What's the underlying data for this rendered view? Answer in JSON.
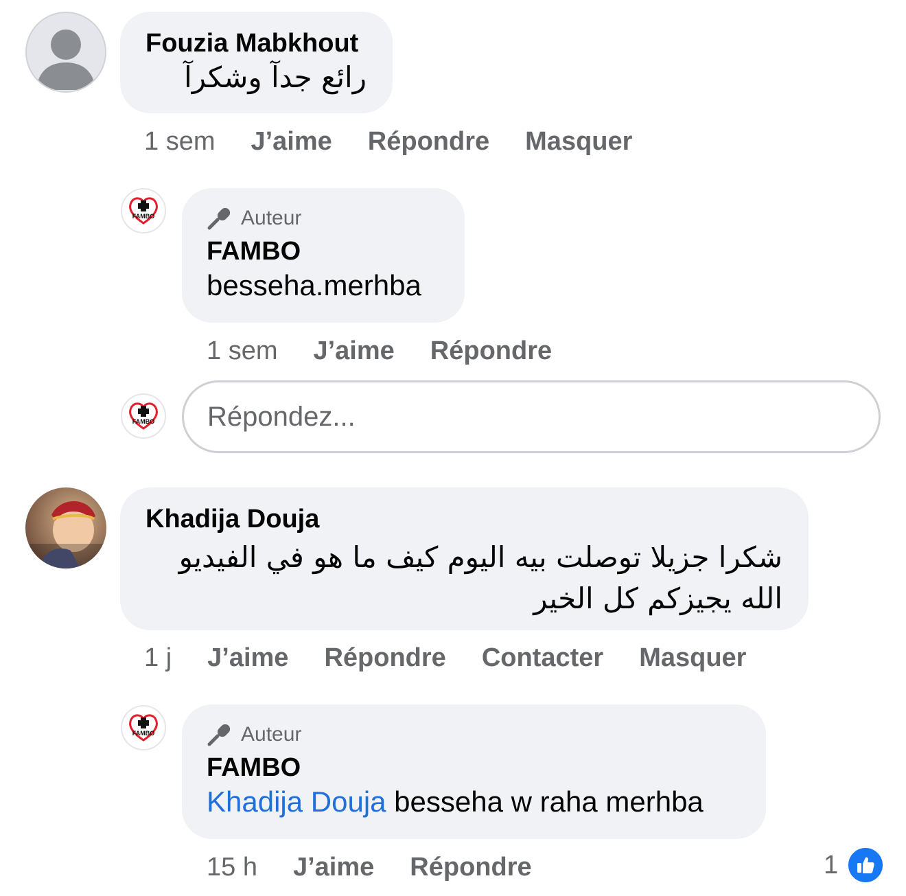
{
  "colors": {
    "bubble_bg": "#f0f2f5",
    "secondary_text": "#65676b",
    "mention": "#216fdb",
    "like_blue": "#1877f2",
    "brand_red": "#e41e2b"
  },
  "comments": [
    {
      "author": "Fouzia Mabkhout",
      "text": "رائع  جدآ  وشكرآ",
      "time": "1 sem",
      "actions": [
        "J’aime",
        "Répondre",
        "Masquer"
      ],
      "replies": [
        {
          "author_badge": "Auteur",
          "author": "FAMBO",
          "text": "besseha.merhba",
          "time": "1 sem",
          "actions": [
            "J’aime",
            "Répondre"
          ]
        }
      ],
      "reply_input": {
        "placeholder": "Répondez..."
      }
    },
    {
      "author": "Khadija Douja",
      "text": "شكرا جزيلا توصلت بيه اليوم كيف ما هو في الفيديو الله يجيزكم كل الخير",
      "time": "1 j",
      "actions": [
        "J’aime",
        "Répondre",
        "Contacter",
        "Masquer"
      ],
      "replies": [
        {
          "author_badge": "Auteur",
          "author": "FAMBO",
          "mention": "Khadija Douja",
          "text": " besseha w raha merhba",
          "time": "15 h",
          "actions": [
            "J’aime",
            "Répondre"
          ],
          "reaction_count": "1",
          "reaction_icon": "thumbs-up-icon"
        }
      ]
    }
  ],
  "icons": {
    "default_avatar": "person-silhouette-icon",
    "author_badge": "microphone-icon",
    "page_logo": "fambo-logo"
  }
}
